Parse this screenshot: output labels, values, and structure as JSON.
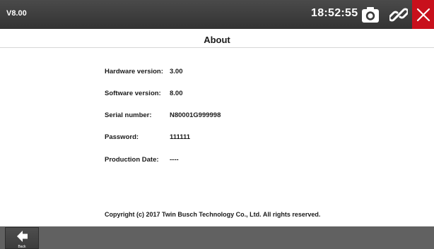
{
  "header": {
    "version": "V8.00",
    "time": "18:52:55",
    "icons": {
      "camera": "camera-icon",
      "link": "link-icon",
      "close": "close-icon"
    },
    "colors": {
      "bar": "#3b3b3b",
      "close": "#c8101c"
    }
  },
  "page": {
    "title": "About"
  },
  "info": [
    {
      "label": "Hardware version:",
      "value": "3.00"
    },
    {
      "label": "Software version:",
      "value": "8.00"
    },
    {
      "label": "Serial number:",
      "value": "N80001G999998"
    },
    {
      "label": "Password:",
      "value": "111111"
    },
    {
      "label": "Production Date:",
      "value": "----"
    }
  ],
  "footer": {
    "copyright": "Copyright (c) 2017 Twin Busch Technology  Co., Ltd. All rights reserved."
  },
  "bottom": {
    "back_label": "Back",
    "back_icon": "back-arrow-icon"
  }
}
